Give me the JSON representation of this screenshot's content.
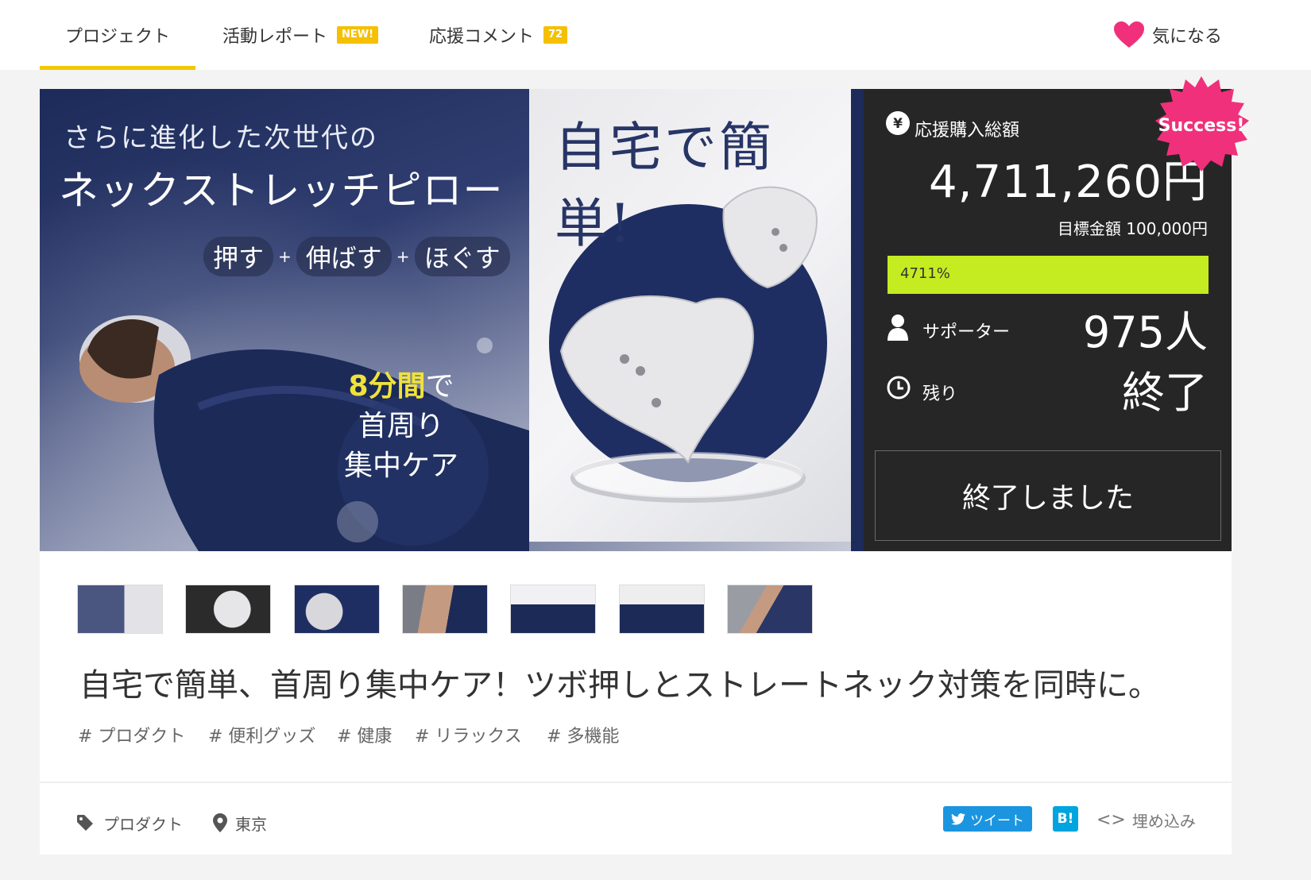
{
  "nav": {
    "tabs": [
      {
        "label": "プロジェクト"
      },
      {
        "label": "活動レポート",
        "badge": "NEW!"
      },
      {
        "label": "応援コメント",
        "badge": "72"
      }
    ],
    "favorite_label": "気になる"
  },
  "hero": {
    "subtitle": "さらに進化した次世代の",
    "product_name": "ネックストレッチピロー",
    "pills": [
      "押す",
      "伸ばす",
      "ほぐす"
    ],
    "circle_highlight": "8分間",
    "circle_suffix": "で",
    "circle_line2": "首周り",
    "circle_line3": "集中ケア",
    "headline": "自宅で簡単!"
  },
  "stats": {
    "total_label": "応援購入総額",
    "total_value": "4,711,260円",
    "goal_text": "目標金額 100,000円",
    "progress_label": "4711%",
    "progress_percent": 4711,
    "supporters_label": "サポーター",
    "supporters_value": "975人",
    "remaining_label": "残り",
    "remaining_value": "終了",
    "ended_button": "終了しました",
    "success_badge": "Success!"
  },
  "project": {
    "title": "自宅で簡単、首周り集中ケア！ツボ押しとストレートネック対策を同時に。",
    "tags": [
      "# プロダクト",
      "# 便利グッズ",
      "# 健康",
      "# リラックス",
      "# 多機能"
    ],
    "category": "プロダクト",
    "location": "東京",
    "tweet_label": "ツイート",
    "hatena_label": "B!",
    "embed_label": "埋め込み"
  },
  "colors": {
    "accent_yellow": "#f2c800",
    "progress_green": "#c5eb21",
    "success_pink": "#f0307a",
    "panel_dark": "#262626",
    "twitter_blue": "#1b95e0",
    "hatena_blue": "#00a4de"
  }
}
